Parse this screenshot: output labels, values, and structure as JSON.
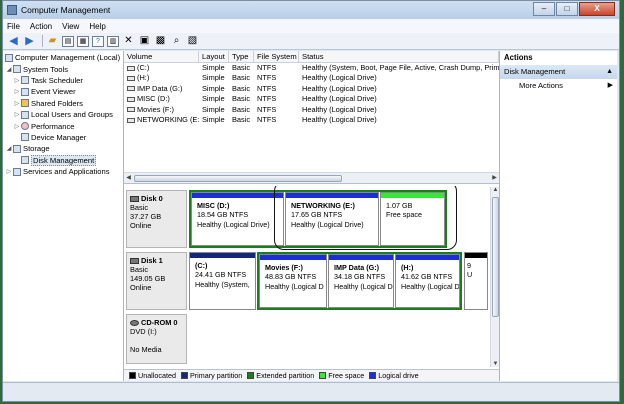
{
  "window": {
    "title": "Computer Management",
    "controls": {
      "minimize": "–",
      "maximize": "□",
      "close": "X"
    }
  },
  "menu": [
    "File",
    "Action",
    "View",
    "Help"
  ],
  "toolbar": {
    "icons": [
      "back-arrow-icon",
      "forward-arrow-icon",
      "up-folder-icon",
      "show-hide-tree-icon",
      "properties-icon",
      "help-icon",
      "show-hide-action-icon",
      "delete-icon",
      "open-icon",
      "save-icon",
      "search-icon",
      "connect-icon"
    ]
  },
  "tree": {
    "items": [
      {
        "label": "Computer Management (Local)",
        "indent": 0,
        "expander": "",
        "icon": "computer-icon"
      },
      {
        "label": "System Tools",
        "indent": 1,
        "expander": "◢",
        "icon": "tools-icon"
      },
      {
        "label": "Task Scheduler",
        "indent": 2,
        "expander": "▷",
        "icon": "clock-icon"
      },
      {
        "label": "Event Viewer",
        "indent": 2,
        "expander": "▷",
        "icon": "event-viewer-icon"
      },
      {
        "label": "Shared Folders",
        "indent": 2,
        "expander": "▷",
        "icon": "folder-icon"
      },
      {
        "label": "Local Users and Groups",
        "indent": 2,
        "expander": "▷",
        "icon": "users-icon"
      },
      {
        "label": "Performance",
        "indent": 2,
        "expander": "▷",
        "icon": "performance-icon"
      },
      {
        "label": "Device Manager",
        "indent": 2,
        "expander": "",
        "icon": "device-manager-icon"
      },
      {
        "label": "Storage",
        "indent": 1,
        "expander": "◢",
        "icon": "storage-icon"
      },
      {
        "label": "Disk Management",
        "indent": 2,
        "expander": "",
        "icon": "disk-icon",
        "selected": true
      },
      {
        "label": "Services and Applications",
        "indent": 1,
        "expander": "▷",
        "icon": "services-icon"
      }
    ]
  },
  "volumes": {
    "columns": [
      "Volume",
      "Layout",
      "Type",
      "File System",
      "Status"
    ],
    "rows": [
      [
        "(C:)",
        "Simple",
        "Basic",
        "NTFS",
        "Healthy (System, Boot, Page File, Active, Crash Dump, Prim"
      ],
      [
        "(H:)",
        "Simple",
        "Basic",
        "NTFS",
        "Healthy (Logical Drive)"
      ],
      [
        "IMP Data (G:)",
        "Simple",
        "Basic",
        "NTFS",
        "Healthy (Logical Drive)"
      ],
      [
        "MISC (D:)",
        "Simple",
        "Basic",
        "NTFS",
        "Healthy (Logical Drive)"
      ],
      [
        "Movies (F:)",
        "Simple",
        "Basic",
        "NTFS",
        "Healthy (Logical Drive)"
      ],
      [
        "NETWORKING (E:)",
        "Simple",
        "Basic",
        "NTFS",
        "Healthy (Logical Drive)"
      ]
    ]
  },
  "disks": [
    {
      "name": "Disk 0",
      "lines": [
        "Basic",
        "37.27 GB",
        "Online"
      ],
      "partitions": [
        {
          "name": "MISC  (D:)",
          "size": "18.54 GB NTFS",
          "status": "Healthy (Logical Drive)",
          "bar": "#1a2fd6"
        },
        {
          "name": "NETWORKING  (E:)",
          "size": "17.65 GB NTFS",
          "status": "Healthy (Logical Drive)",
          "bar": "#1a2fd6"
        },
        {
          "name": "",
          "size": "1.07 GB",
          "status": "Free space",
          "bar": "#35e835"
        }
      ]
    },
    {
      "name": "Disk 1",
      "lines": [
        "Basic",
        "149.05 GB",
        "Online"
      ],
      "partitions": [
        {
          "name": "(C:)",
          "size": "24.41 GB NTFS",
          "status": "Healthy (System,",
          "bar": "#14277a"
        },
        {
          "name": "Movies  (F:)",
          "size": "48.83 GB NTFS",
          "status": "Healthy (Logical D",
          "bar": "#1a2fd6"
        },
        {
          "name": "IMP Data  (G:)",
          "size": "34.18 GB NTFS",
          "status": "Healthy (Logical D",
          "bar": "#1a2fd6"
        },
        {
          "name": "(H:)",
          "size": "41.62 GB NTFS",
          "status": "Healthy (Logical D",
          "bar": "#1a2fd6"
        },
        {
          "name": "",
          "size": "9",
          "status": "U",
          "bar": "#000000"
        }
      ]
    },
    {
      "name": "CD-ROM 0",
      "lines": [
        "DVD (I:)",
        "",
        "No Media"
      ],
      "partitions": []
    }
  ],
  "legend": [
    {
      "label": "Unallocated",
      "color": "#000000"
    },
    {
      "label": "Primary partition",
      "color": "#14277a"
    },
    {
      "label": "Extended partition",
      "color": "#1c7d1c"
    },
    {
      "label": "Free space",
      "color": "#35e835"
    },
    {
      "label": "Logical drive",
      "color": "#1a2fd6"
    }
  ],
  "actions": {
    "header": "Actions",
    "section": "Disk Management",
    "items": [
      "More Actions"
    ]
  }
}
